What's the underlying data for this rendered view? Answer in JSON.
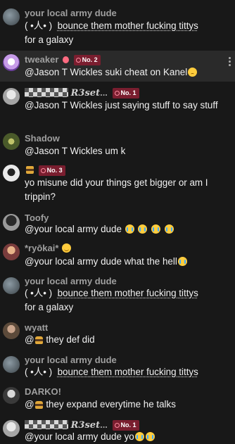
{
  "messages": [
    {
      "author": "your local army dude",
      "text1": "( •人• )",
      "text2": "bounce them mother fucking tittys",
      "text3": "for a galaxy"
    },
    {
      "author": "tweaker",
      "badge": "No. 2",
      "mention": "@Jason T Wickles",
      "text": " suki cheat on Kanel",
      "emoji": "pensive"
    },
    {
      "author_suffix": "R3set",
      "author_trail": "...",
      "badge": "No. 1",
      "text": "@Jason T Wickles just saying stuff to say stuff"
    },
    {
      "author": "Shadow",
      "text": "@Jason T Wickles um k"
    },
    {
      "badge": "No. 3",
      "text": "yo misune did your things get bigger or am I trippin?"
    },
    {
      "author": "Toofy",
      "text": "@your local army dude ",
      "emoji_count": 4
    },
    {
      "author": "*ryōkai*",
      "text": "@your local army dude what the hell"
    },
    {
      "author": "your local army dude",
      "text1": "( •人• )",
      "text2": "bounce them mother fucking tittys",
      "text3": "for a galaxy"
    },
    {
      "author": "wyatt",
      "text_pre": "@",
      "text": " they def did"
    },
    {
      "author": "your local army dude",
      "text1": "( •人• )",
      "text2": "bounce them mother fucking tittys"
    },
    {
      "author": "DARKO!",
      "text_pre": "@",
      "text": " they expand everytime he talks"
    },
    {
      "author_suffix": "R3set",
      "author_trail": "...",
      "badge": "No. 1",
      "text": "@your local army dude yo"
    }
  ],
  "icons": {
    "more": "more-vert-icon",
    "gifter": "gift-icon",
    "crying": "loudly-crying-face-emoji",
    "burger": "burger-emoji"
  },
  "colors": {
    "background": "#181818",
    "highlight": "#2a2a2a",
    "author": "#9f9f9f",
    "badge": "#7a1e2f"
  }
}
